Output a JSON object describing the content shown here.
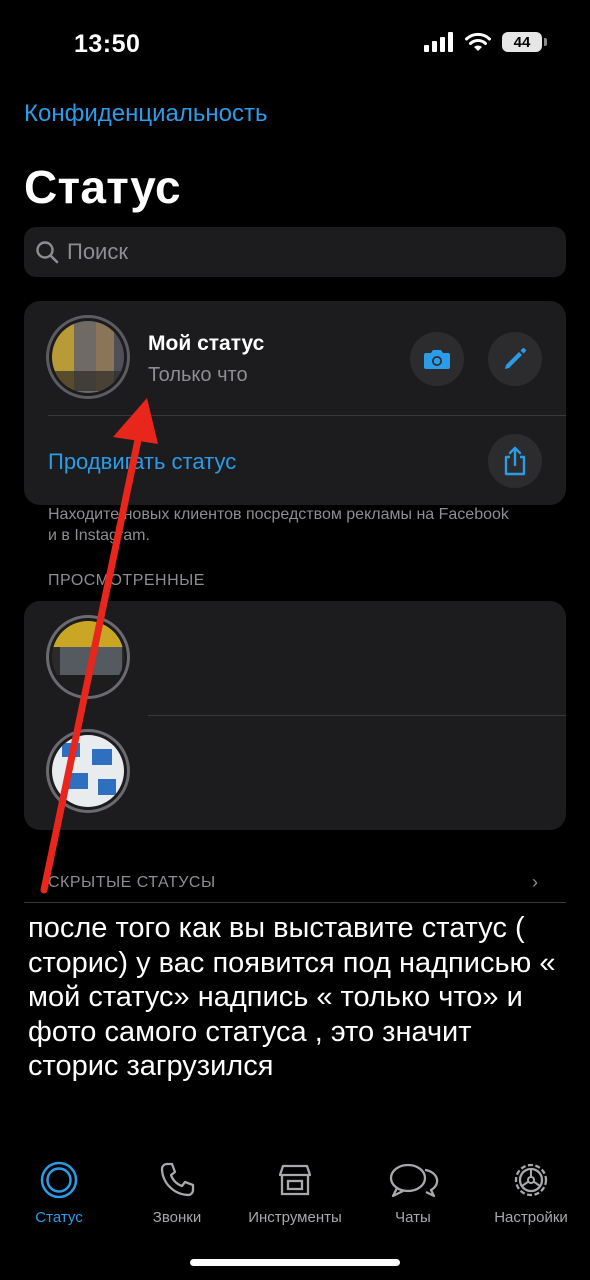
{
  "status_bar": {
    "time": "13:50",
    "battery": "44"
  },
  "header": {
    "privacy_link": "Конфиденциальность",
    "title": "Статус",
    "search_placeholder": "Поиск"
  },
  "my_status": {
    "name": "Мой статус",
    "subtitle": "Только что",
    "promote_label": "Продвигать статус",
    "footnote": "Находите новых клиентов посредством рекламы на Facebook и в Instagram."
  },
  "viewed": {
    "header": "ПРОСМОТРЕННЫЕ"
  },
  "hidden": {
    "header": "СКРЫТЫЕ СТАТУСЫ"
  },
  "overlay_text": "после того как вы выставите статус ( сторис) у вас появится под надписью « мой статус» надпись « только что» и фото самого статуса , это значит сторис загрузился",
  "tabs": [
    {
      "label": "Статус",
      "icon": "status-icon",
      "active": true
    },
    {
      "label": "Звонки",
      "icon": "phone-icon",
      "active": false
    },
    {
      "label": "Инструменты",
      "icon": "store-icon",
      "active": false
    },
    {
      "label": "Чаты",
      "icon": "chat-icon",
      "active": false
    },
    {
      "label": "Настройки",
      "icon": "gear-icon",
      "active": false
    }
  ],
  "colors": {
    "accent": "#2a9ce8",
    "arrow": "#e8261c",
    "card": "#1c1c1e"
  }
}
